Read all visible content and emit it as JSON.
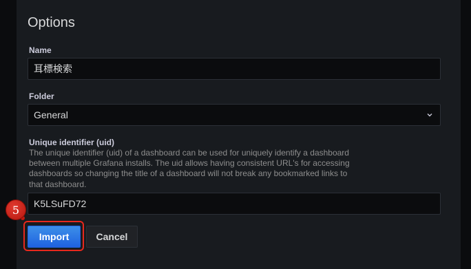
{
  "options": {
    "title": "Options",
    "name_label": "Name",
    "name_value": "耳標検索",
    "folder_label": "Folder",
    "folder_value": "General",
    "uid_label": "Unique identifier (uid)",
    "uid_description": "The unique identifier (uid) of a dashboard can be used for uniquely identify a dashboard between multiple Grafana installs. The uid allows having consistent URL's for accessing dashboards so changing the title of a dashboard will not break any bookmarked links to that dashboard.",
    "uid_value": "K5LSuFD72"
  },
  "actions": {
    "import_label": "Import",
    "cancel_label": "Cancel"
  },
  "annotation": {
    "step_number": "5",
    "color": "#e8281d"
  },
  "icons": {
    "folder_dropdown": "chevron-down-icon"
  }
}
